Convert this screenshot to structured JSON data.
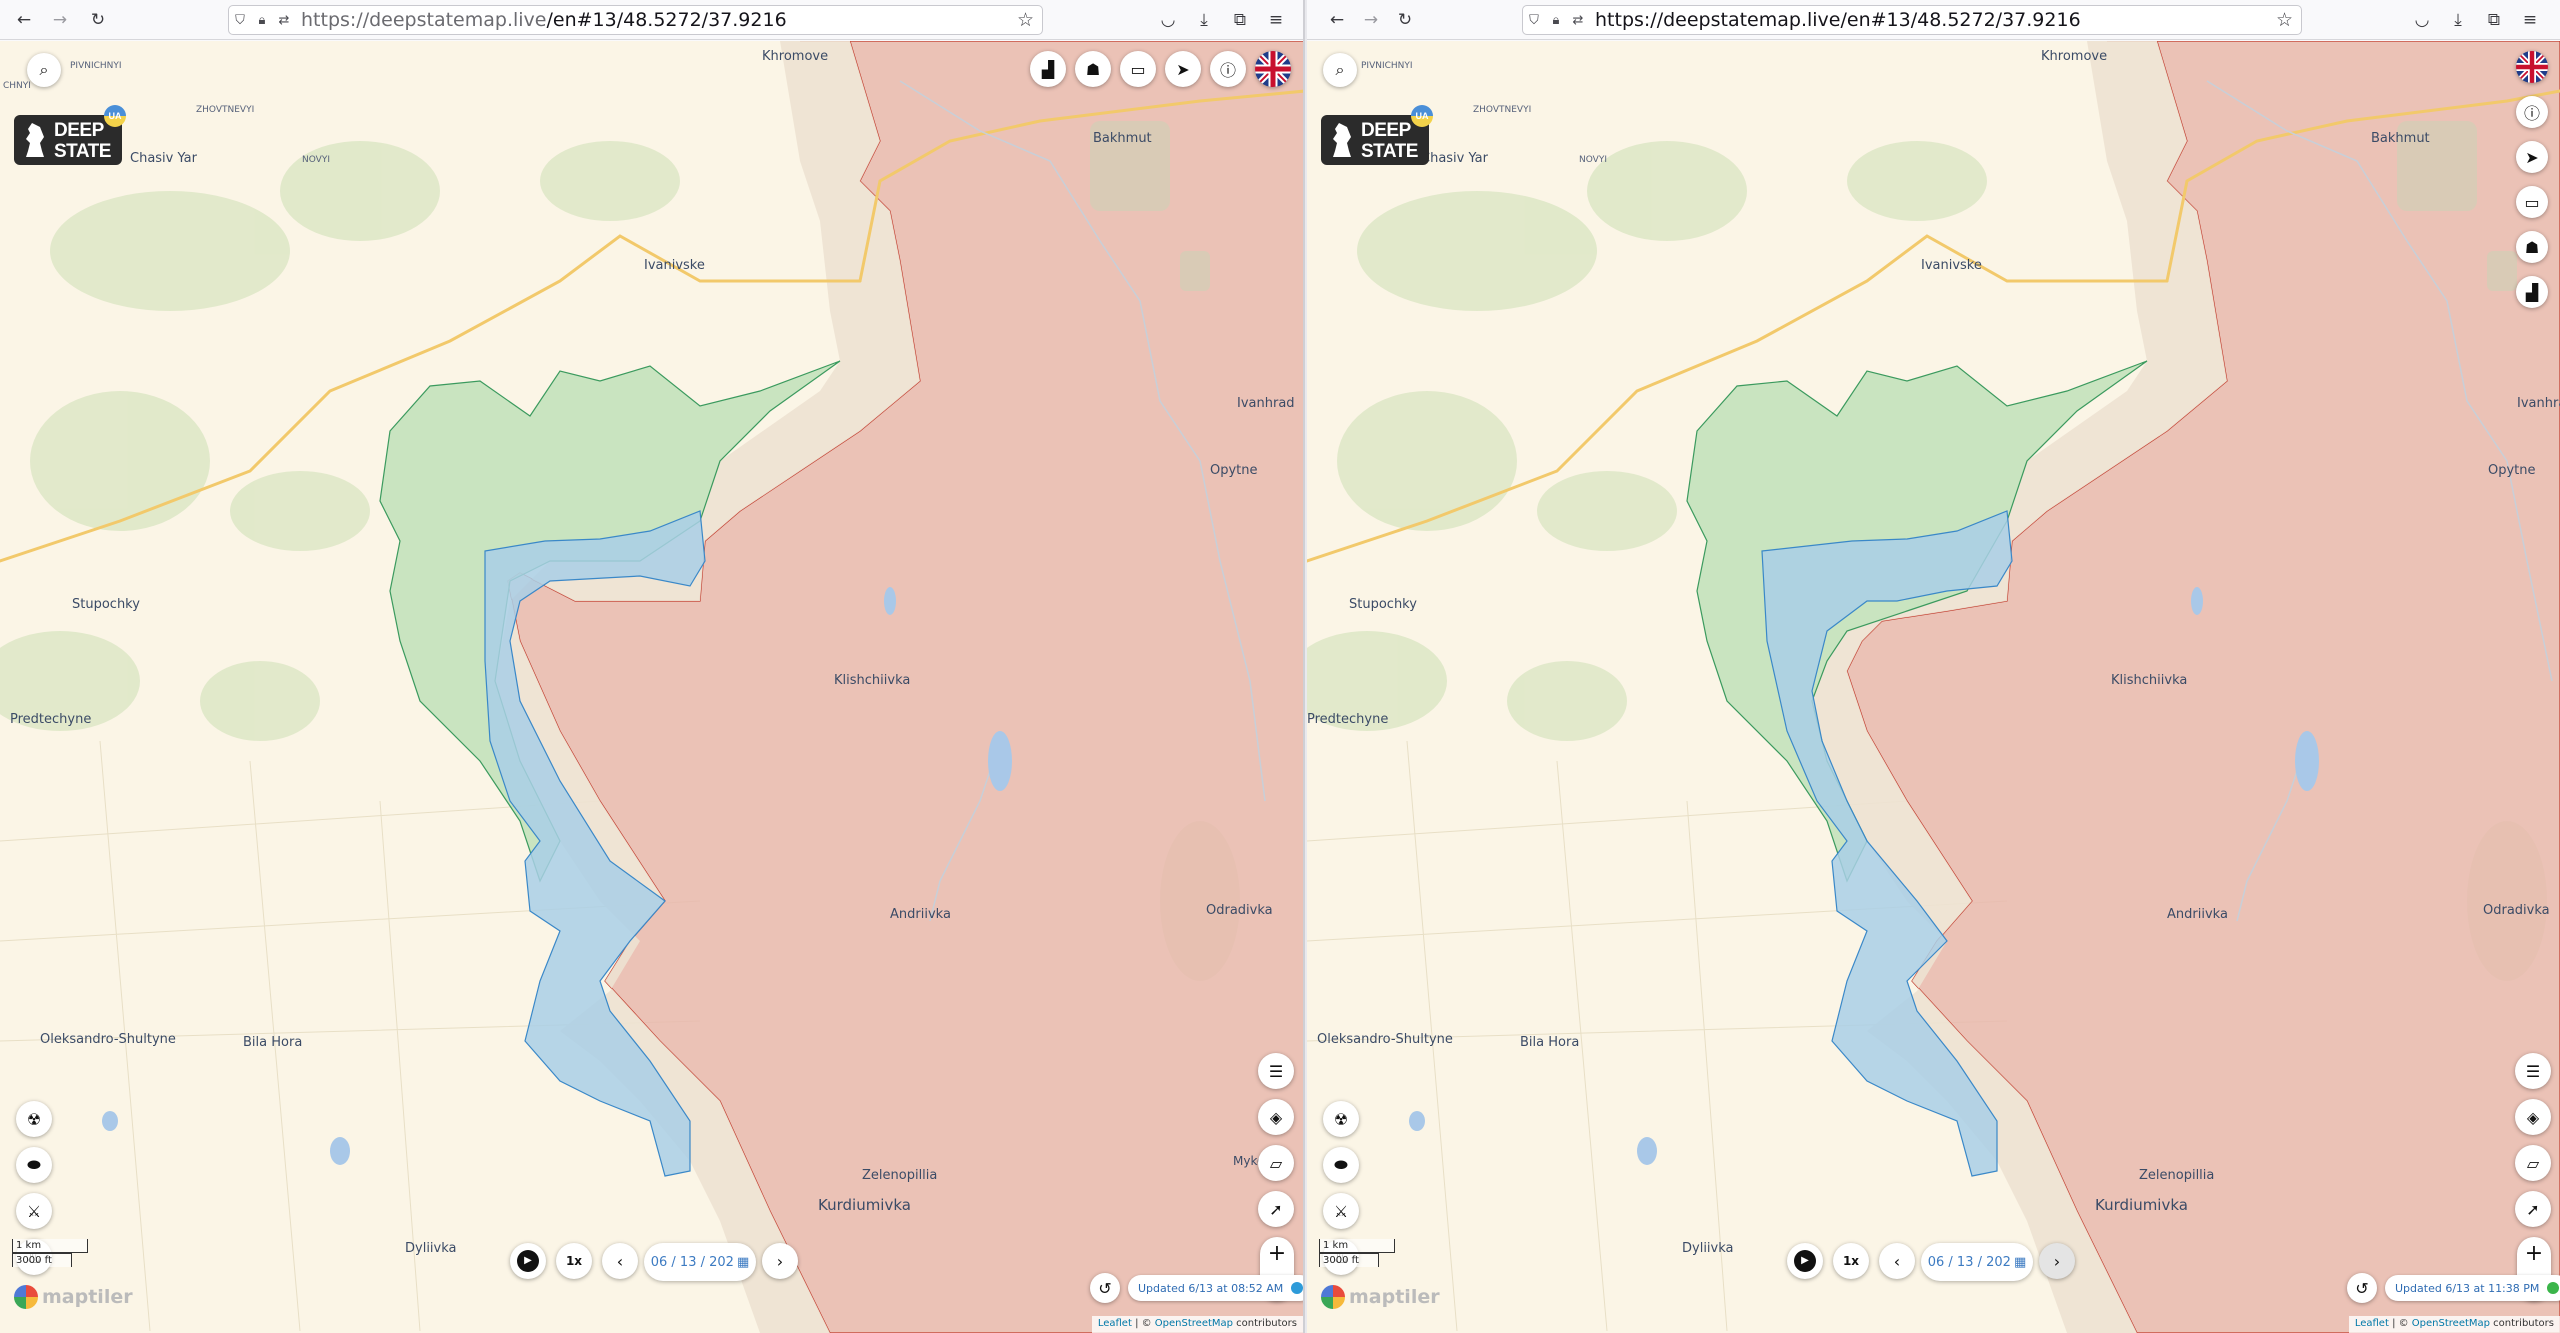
{
  "colors": {
    "occupied": "#e8b9ad",
    "liberated": "#a9d8a6",
    "contested_blue": "#a9cfe6",
    "gray_zone": "#eadfcf",
    "base": "#fbf5e6"
  },
  "left": {
    "url": {
      "host": "https://deepstatemap.live",
      "path": "/en#13/48.5272/37.9216"
    },
    "date": "06 / 13 / 202",
    "speed": "1x",
    "updated": "Updated 6/13 at 08:52 AM",
    "updated_dot": "#2e9bd9"
  },
  "right": {
    "url": {
      "host": "https://deepstatemap.live",
      "path": "/en#13/48.5272/37.9216"
    },
    "date": "06 / 13 / 202",
    "speed": "1x",
    "updated": "Updated 6/13 at 11:38 PM",
    "updated_dot": "#3bb54a"
  },
  "logo": {
    "line1": "DEEP",
    "line2": "STATE",
    "badge": "UA"
  },
  "places": {
    "khromove": "Khromove",
    "bakhmut": "Bakhmut",
    "chasiv_yar": "Chasiv Yar",
    "ivanivske": "Ivanivske",
    "ivanhrad": "Ivanhrad",
    "opytne": "Opytne",
    "stupochky": "Stupochky",
    "predtechyne": "Predtechyne",
    "klishchiivka": "Klishchiivka",
    "andriivka": "Andriivka",
    "odradivka": "Odradivka",
    "oleksandro_shultyne": "Oleksandro-Shultyne",
    "bila_hora": "Bila Hora",
    "zelenopillia": "Zelenopillia",
    "kurdiumivka": "Kurdiumivka",
    "dyliivka": "Dyliivka",
    "pivnichnyi": "PIVNICHNYI",
    "zhovtnevyi": "ZHOVTNEVYI",
    "novyi": "NOVYI",
    "chnyi": "CHNYI",
    "mykol": "Myk",
    "mykol2": "Mykol"
  },
  "scale": {
    "metric": "1 km",
    "imperial": "3000 ft"
  },
  "brand": {
    "maptiler": "maptiler"
  },
  "attribution": {
    "leaflet": "Leaflet",
    "sep1": " | © ",
    "osm": "OpenStreetMap",
    "contrib": " contributors"
  },
  "icons": {
    "search": "search-icon",
    "stats": "bar-chart-icon",
    "bot": "robot-icon",
    "donate": "money-icon",
    "telegram": "telegram-icon",
    "info": "info-icon",
    "flag": "uk-flag-icon",
    "filters": "sliders-icon",
    "layers": "layers-icon",
    "ruler": "ruler-icon",
    "locate": "location-arrow-icon",
    "radiation": "radiation-icon",
    "pills": "pills-icon",
    "weapon": "rocket-icon",
    "fire": "fire-icon",
    "history": "history-icon",
    "play": "play-icon"
  }
}
